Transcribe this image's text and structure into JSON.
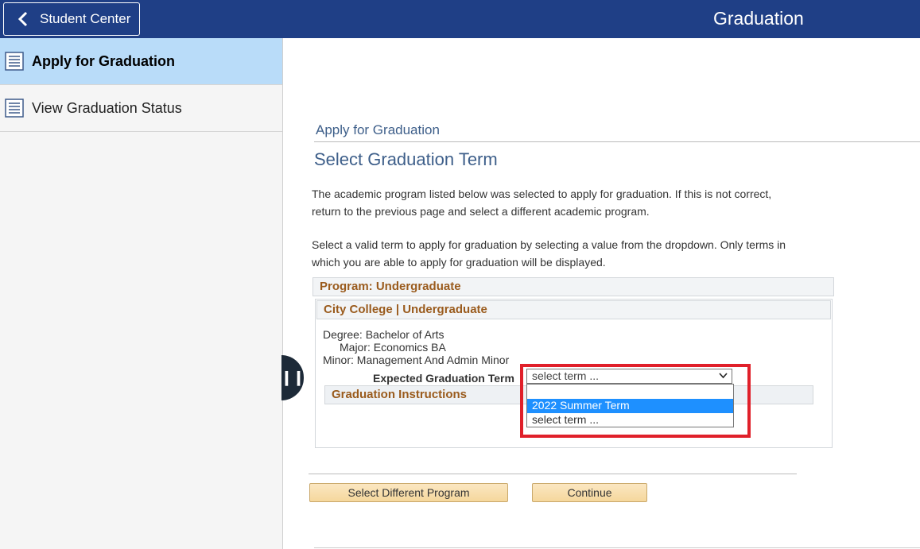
{
  "header": {
    "back_label": "Student Center",
    "title": "Graduation",
    "color": "#1f3f86"
  },
  "sidebar": {
    "items": [
      {
        "label": "Apply for Graduation",
        "icon": "list-page-icon",
        "active": true
      },
      {
        "label": "View Graduation Status",
        "icon": "list-page-icon",
        "active": false
      }
    ]
  },
  "main": {
    "breadcrumb": "Apply for Graduation",
    "title": "Select Graduation Term",
    "para1": [
      "The academic program listed below was selected to apply for graduation. If this is not correct,",
      "return to the previous page and select a different academic program."
    ],
    "para2": [
      "Select a valid term to apply for graduation by selecting a value from the dropdown. Only terms in",
      "which you are able to apply for graduation will be displayed."
    ],
    "program_header": "Program: Undergraduate",
    "career_header": "City College | Undergraduate",
    "degree": "Degree: Bachelor of Arts",
    "major": "Major: Economics BA",
    "minor": "Minor: Management And Admin Minor",
    "term_label": "Expected Graduation Term",
    "term_select": {
      "value": "select term ...",
      "options": [
        "2022 Summer Term",
        "select term ..."
      ],
      "highlighted": "2022 Summer Term"
    },
    "instructions_header": "Graduation Instructions",
    "buttons": {
      "different_program": "Select Different Program",
      "continue": "Continue"
    }
  },
  "colors": {
    "accent_blue": "#3e5f8a",
    "section_header": "#9a5b1d",
    "highlight_box": "#e0202a",
    "active_sidebar": "#b9dcf9"
  }
}
